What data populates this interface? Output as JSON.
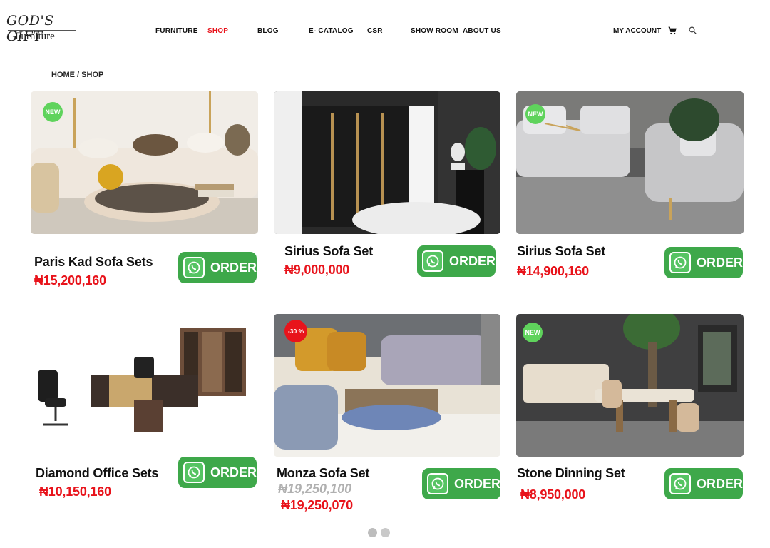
{
  "brand": {
    "name_top": "GOD'S GIFT",
    "name_bottom": "Furniture"
  },
  "nav": {
    "items": [
      {
        "label": "FURNITURE"
      },
      {
        "label": "SHOP"
      },
      {
        "label": "BLOG"
      },
      {
        "label": "E- CATALOG"
      },
      {
        "label": "CSR"
      },
      {
        "label": "SHOW ROOM"
      },
      {
        "label": "ABOUT US"
      }
    ],
    "active": "SHOP",
    "account": "MY ACCOUNT"
  },
  "breadcrumb": "HOME / SHOP",
  "order_label": "ORDER",
  "products": [
    {
      "name": "Paris  Kad Sofa Sets",
      "price": "₦15,200,160",
      "tag": "NEW"
    },
    {
      "name": "Sirius Sofa Set",
      "price": "₦9,000,000",
      "tag": ""
    },
    {
      "name": "Sirius Sofa Set",
      "price": "₦14,900,160",
      "tag": "NEW"
    },
    {
      "name": "Diamond Office Sets",
      "price": "₦10,150,160",
      "tag": ""
    },
    {
      "name": "Monza Sofa Set",
      "old_price": "₦19,250,100",
      "price": "₦19,250,070",
      "tag": "-30 %"
    },
    {
      "name": "Stone Dinning Set",
      "price": "₦8,950,000",
      "tag": "NEW"
    }
  ],
  "colors": {
    "accent": "#e8131b",
    "whatsapp_green": "#3ea84a",
    "new_badge": "#5fd35c"
  }
}
